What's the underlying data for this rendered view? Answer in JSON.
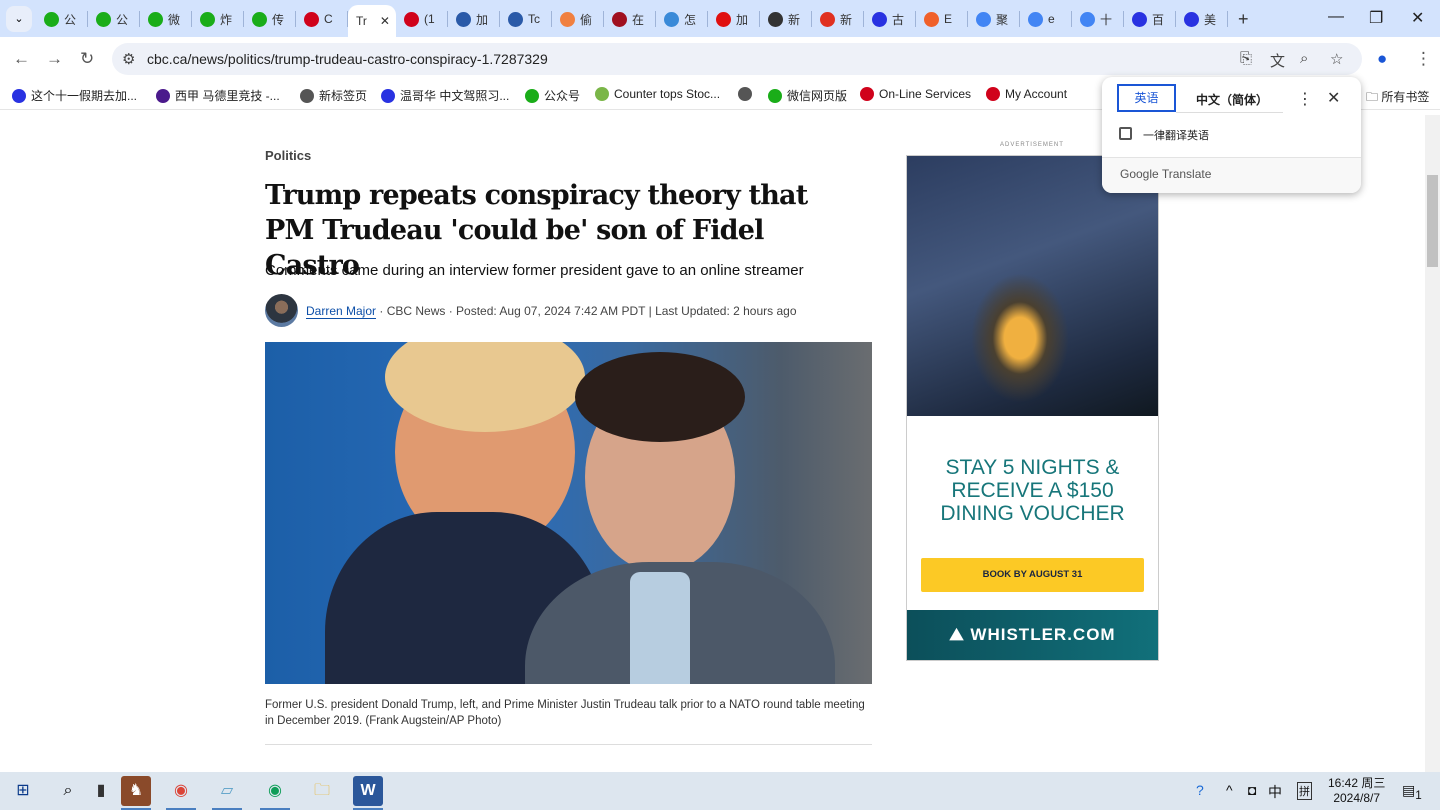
{
  "browser": {
    "tabs": [
      {
        "label": "公",
        "color": "#1aad19"
      },
      {
        "label": "公",
        "color": "#1aad19"
      },
      {
        "label": "微",
        "color": "#1aad19"
      },
      {
        "label": "炸",
        "color": "#1aad19"
      },
      {
        "label": "传",
        "color": "#1aad19"
      },
      {
        "label": "C",
        "color": "#d0021b"
      },
      {
        "label": "Tr",
        "color": "",
        "active": true
      },
      {
        "label": "(1",
        "color": "#d0021b"
      },
      {
        "label": "加",
        "color": "#2a5aa8"
      },
      {
        "label": "Tc",
        "color": "#2a5aa8"
      },
      {
        "label": "偷",
        "color": "#f08040"
      },
      {
        "label": "在",
        "color": "#a01020"
      },
      {
        "label": "怎",
        "color": "#3a8ad8"
      },
      {
        "label": "加",
        "color": "#e01010"
      },
      {
        "label": "新",
        "color": "#333333"
      },
      {
        "label": "新",
        "color": "#e03020"
      },
      {
        "label": "古",
        "color": "#2932e1"
      },
      {
        "label": "E",
        "color": "#f0602a"
      },
      {
        "label": "聚",
        "color": "#4285f4"
      },
      {
        "label": "e",
        "color": "#4285f4"
      },
      {
        "label": "十",
        "color": "#4285f4"
      },
      {
        "label": "百",
        "color": "#2932e1"
      },
      {
        "label": "美",
        "color": "#2932e1"
      }
    ],
    "new_tab": "+",
    "url": "cbc.ca/news/politics/trump-trudeau-castro-conspiracy-1.7287329",
    "bookmarks": [
      {
        "label": "这个十一假期去加...",
        "color": "#2932e1"
      },
      {
        "label": "西甲 马德里竞技 -...",
        "color": "#4b1a8c"
      },
      {
        "label": "新标签页",
        "color": "#555555"
      },
      {
        "label": "温哥华 中文驾照习...",
        "color": "#2932e1"
      },
      {
        "label": "公众号",
        "color": "#1aad19"
      },
      {
        "label": "Counter tops Stoc...",
        "color": "#7ab648"
      },
      {
        "label": "",
        "color": "#555555"
      },
      {
        "label": "微信网页版",
        "color": "#1aad19"
      },
      {
        "label": "On-Line Services",
        "color": "#d0021b"
      },
      {
        "label": "My Account",
        "color": "#d0021b"
      }
    ],
    "all_bookmarks": "所有书签"
  },
  "translate": {
    "source": "英语",
    "target": "中文（简体）",
    "always_translate": "一律翻译英语",
    "always_checked": false,
    "footer": "Google Translate"
  },
  "article": {
    "section": "Politics",
    "headline": "Trump repeats conspiracy theory that PM Trudeau 'could be' son of Fidel Castro",
    "deck": "Comments came during an interview former president gave to an online streamer",
    "author": "Darren Major",
    "byline_rest": "· CBC News · Posted: Aug 07, 2024 7:42 AM PDT | Last Updated: 2 hours ago",
    "caption": "Former U.S. president Donald Trump, left, and Prime Minister Justin Trudeau talk prior to a NATO round table meeting in December 2019. (Frank Augstein/AP Photo)"
  },
  "ad": {
    "label": "ADVERTISEMENT",
    "headline": "STAY 5 NIGHTS &\nRECEIVE A $150\nDINING VOUCHER",
    "cta": "BOOK BY AUGUST 31",
    "brand": "WHISTLER.COM"
  },
  "taskbar": {
    "time": "16:42 周三",
    "date": "2024/8/7",
    "ime_lang": "中",
    "ime_mode": "拼",
    "notifications": "1"
  }
}
